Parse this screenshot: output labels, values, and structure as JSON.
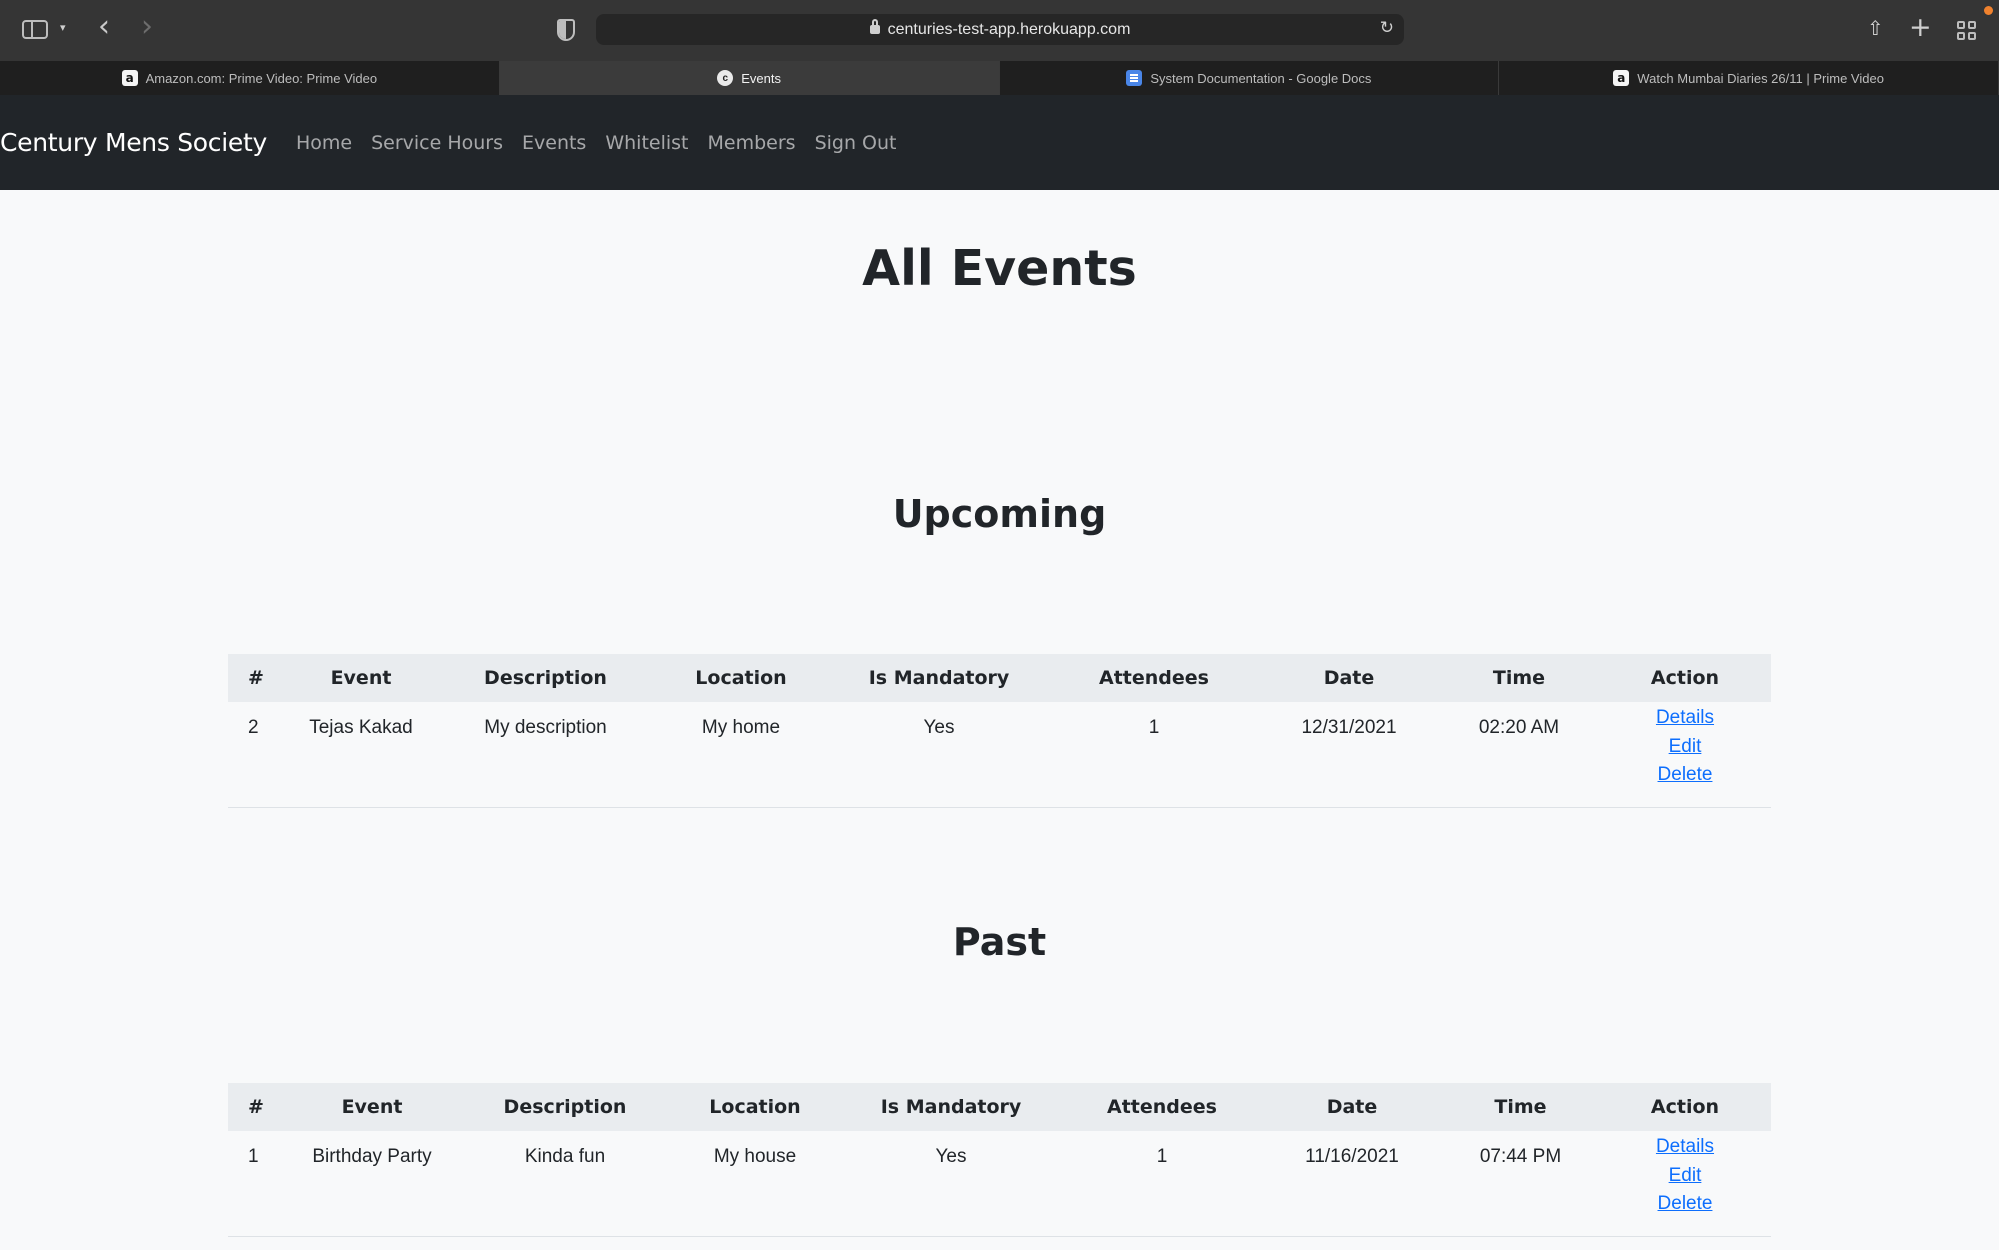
{
  "browser": {
    "url": "centuries-test-app.herokuapp.com",
    "tabs": [
      {
        "label": "Amazon.com: Prime Video: Prime Video",
        "icon": "amazon-icon",
        "active": false
      },
      {
        "label": "Events",
        "icon": "site-c-icon",
        "active": true
      },
      {
        "label": "System Documentation - Google Docs",
        "icon": "google-docs-icon",
        "active": false
      },
      {
        "label": "Watch Mumbai Diaries 26/11 | Prime Video",
        "icon": "amazon-icon",
        "active": false
      }
    ]
  },
  "navbar": {
    "brand": "Century Mens Society",
    "links": [
      "Home",
      "Service Hours",
      "Events",
      "Whitelist",
      "Members",
      "Sign Out"
    ]
  },
  "page": {
    "title": "All Events"
  },
  "upcoming": {
    "heading": "Upcoming",
    "columns": [
      "#",
      "Event",
      "Description",
      "Location",
      "Is Mandatory",
      "Attendees",
      "Date",
      "Time",
      "Action"
    ],
    "rows": [
      {
        "num": "2",
        "event": "Tejas Kakad",
        "description": "My description",
        "location": "My home",
        "mandatory": "Yes",
        "attendees": "1",
        "date": "12/31/2021",
        "time": "02:20 AM",
        "actions": [
          "Details",
          "Edit",
          "Delete"
        ]
      }
    ]
  },
  "past": {
    "heading": "Past",
    "columns": [
      "#",
      "Event",
      "Description",
      "Location",
      "Is Mandatory",
      "Attendees",
      "Date",
      "Time",
      "Action"
    ],
    "rows": [
      {
        "num": "1",
        "event": "Birthday Party",
        "description": "Kinda fun",
        "location": "My house",
        "mandatory": "Yes",
        "attendees": "1",
        "date": "11/16/2021",
        "time": "07:44 PM",
        "actions": [
          "Details",
          "Edit",
          "Delete"
        ]
      }
    ]
  },
  "colors": {
    "navbar_bg": "#212529",
    "link": "#0d6efd",
    "table_header_bg": "#e9ecef"
  }
}
